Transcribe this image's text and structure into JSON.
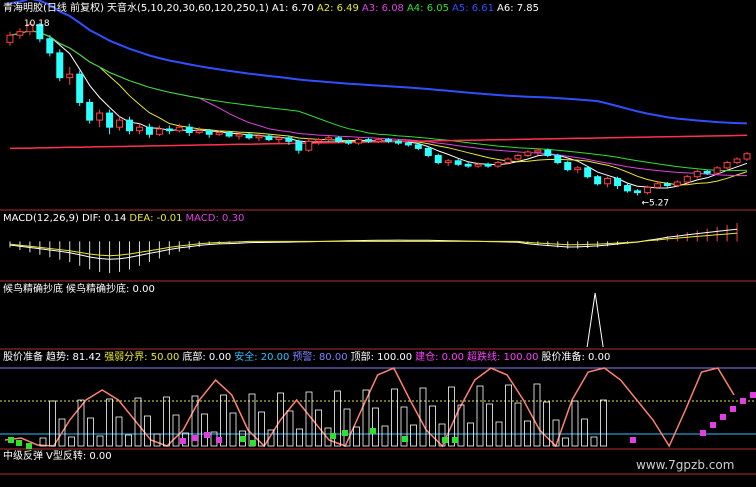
{
  "panel1": {
    "title": "青海明胶(日线 前复权)",
    "indicator": "天音水(5,10,20,30,60,120,250,1)",
    "readings": [
      {
        "label": "A1: 6.70",
        "color": "#ffffff"
      },
      {
        "label": "A2: 6.49",
        "color": "#e8e830"
      },
      {
        "label": "A3: 6.08",
        "color": "#e040e0"
      },
      {
        "label": "A4: 6.05",
        "color": "#30e030"
      },
      {
        "label": "A5: 6.61",
        "color": "#3050ff"
      },
      {
        "label": "A6: 7.85",
        "color": "#ffffff"
      }
    ],
    "high_label": "10.18",
    "low_label": "5.27"
  },
  "panel2": {
    "title": "MACD(12,26,9)",
    "readings": [
      {
        "label": "DIF: 0.14",
        "color": "#ffffff"
      },
      {
        "label": "DEA: -0.01",
        "color": "#e8e830"
      },
      {
        "label": "MACD: 0.30",
        "color": "#e040e0"
      }
    ]
  },
  "panel3": {
    "title": "候鸟精确抄底",
    "readings": [
      {
        "label": "候鸟精确抄底: 0.00",
        "color": "#ffffff"
      }
    ]
  },
  "panel4": {
    "title": "股价准备",
    "readings": [
      {
        "label": "趋势: 81.42",
        "color": "#ffffff"
      },
      {
        "label": "强弱分界: 50.00",
        "color": "#e8e830"
      },
      {
        "label": "底部: 0.00",
        "color": "#ffffff"
      },
      {
        "label": "安全: 20.00",
        "color": "#30c0ff"
      },
      {
        "label": "预警: 80.00",
        "color": "#8080ff"
      },
      {
        "label": "顶部: 100.00",
        "color": "#ffffff"
      },
      {
        "label": "建仓: 0.00",
        "color": "#ff40ff"
      },
      {
        "label": "超跌线: 100.00",
        "color": "#ff40ff"
      },
      {
        "label": "股价准备: 0.00",
        "color": "#ffffff"
      }
    ]
  },
  "panel5": {
    "title": "中级反弹",
    "readings": [
      {
        "label": "V型反转: 0.00",
        "color": "#ffffff"
      }
    ]
  },
  "watermark": "www.7gpzb.com",
  "colors": {
    "up": "#ff4040",
    "down": "#30ffff",
    "ma5": "#ffffff",
    "ma10": "#e8e830",
    "ma20": "#e040e0",
    "ma30": "#30e030",
    "ma60": "#3050ff",
    "ma250": "#ff3050",
    "divider": "#b03030"
  },
  "chart_data": [
    {
      "type": "candlestick",
      "title": "青海明胶(日线 前复权)",
      "candles": [
        [
          9.6,
          9.8,
          9.5,
          9.9
        ],
        [
          9.8,
          9.9,
          9.7,
          10.0
        ],
        [
          9.9,
          10.1,
          9.8,
          10.18
        ],
        [
          10.1,
          9.7,
          9.6,
          10.15
        ],
        [
          9.7,
          9.3,
          9.2,
          9.8
        ],
        [
          9.3,
          8.6,
          8.5,
          9.4
        ],
        [
          8.6,
          8.7,
          8.4,
          8.9
        ],
        [
          8.7,
          7.9,
          7.8,
          8.8
        ],
        [
          7.9,
          7.4,
          7.3,
          8.0
        ],
        [
          7.4,
          7.6,
          7.2,
          7.7
        ],
        [
          7.6,
          7.2,
          7.0,
          7.7
        ],
        [
          7.2,
          7.4,
          7.1,
          7.5
        ],
        [
          7.4,
          7.1,
          7.0,
          7.5
        ],
        [
          7.1,
          7.2,
          7.0,
          7.3
        ],
        [
          7.2,
          7.0,
          6.9,
          7.3
        ],
        [
          7.0,
          7.15,
          6.95,
          7.25
        ],
        [
          7.15,
          7.1,
          7.0,
          7.25
        ],
        [
          7.1,
          7.2,
          7.05,
          7.3
        ],
        [
          7.2,
          7.05,
          6.95,
          7.3
        ],
        [
          7.05,
          7.1,
          7.0,
          7.2
        ],
        [
          7.1,
          7.0,
          6.9,
          7.15
        ],
        [
          7.0,
          7.05,
          6.95,
          7.1
        ],
        [
          7.05,
          6.95,
          6.9,
          7.1
        ],
        [
          6.95,
          7.0,
          6.85,
          7.05
        ],
        [
          7.0,
          6.9,
          6.85,
          7.05
        ],
        [
          6.9,
          6.95,
          6.8,
          7.0
        ],
        [
          6.95,
          6.85,
          6.8,
          7.0
        ],
        [
          6.85,
          6.9,
          6.75,
          6.95
        ],
        [
          6.9,
          6.8,
          6.7,
          6.95
        ],
        [
          6.8,
          6.55,
          6.45,
          6.85
        ],
        [
          6.55,
          6.8,
          6.5,
          6.9
        ],
        [
          6.8,
          6.85,
          6.7,
          6.9
        ],
        [
          6.85,
          6.9,
          6.8,
          6.95
        ],
        [
          6.9,
          6.8,
          6.75,
          6.95
        ],
        [
          6.8,
          6.75,
          6.7,
          6.85
        ],
        [
          6.75,
          6.85,
          6.7,
          6.9
        ],
        [
          6.85,
          6.8,
          6.75,
          6.9
        ],
        [
          6.8,
          6.85,
          6.75,
          6.9
        ],
        [
          6.85,
          6.8,
          6.75,
          6.9
        ],
        [
          6.8,
          6.75,
          6.7,
          6.85
        ],
        [
          6.75,
          6.7,
          6.65,
          6.8
        ],
        [
          6.7,
          6.6,
          6.55,
          6.75
        ],
        [
          6.6,
          6.4,
          6.35,
          6.65
        ],
        [
          6.4,
          6.2,
          6.15,
          6.45
        ],
        [
          6.2,
          6.25,
          6.1,
          6.3
        ],
        [
          6.25,
          6.15,
          6.1,
          6.3
        ],
        [
          6.15,
          6.1,
          6.05,
          6.2
        ],
        [
          6.1,
          6.15,
          6.05,
          6.2
        ],
        [
          6.15,
          6.1,
          6.05,
          6.2
        ],
        [
          6.1,
          6.2,
          6.05,
          6.25
        ],
        [
          6.2,
          6.3,
          6.15,
          6.35
        ],
        [
          6.3,
          6.4,
          6.25,
          6.45
        ],
        [
          6.4,
          6.5,
          6.35,
          6.55
        ],
        [
          6.5,
          6.55,
          6.4,
          6.6
        ],
        [
          6.55,
          6.4,
          6.35,
          6.6
        ],
        [
          6.4,
          6.2,
          6.15,
          6.45
        ],
        [
          6.2,
          6.0,
          5.95,
          6.25
        ],
        [
          6.0,
          6.05,
          5.9,
          6.1
        ],
        [
          6.05,
          5.8,
          5.75,
          6.1
        ],
        [
          5.8,
          5.6,
          5.55,
          5.85
        ],
        [
          5.6,
          5.75,
          5.5,
          5.8
        ],
        [
          5.75,
          5.55,
          5.45,
          5.8
        ],
        [
          5.55,
          5.4,
          5.35,
          5.6
        ],
        [
          5.4,
          5.35,
          5.27,
          5.45
        ],
        [
          5.35,
          5.5,
          5.3,
          5.55
        ],
        [
          5.5,
          5.6,
          5.45,
          5.65
        ],
        [
          5.6,
          5.55,
          5.5,
          5.65
        ],
        [
          5.55,
          5.65,
          5.5,
          5.7
        ],
        [
          5.65,
          5.8,
          5.6,
          5.85
        ],
        [
          5.8,
          5.95,
          5.75,
          6.0
        ],
        [
          5.95,
          5.9,
          5.85,
          6.0
        ],
        [
          5.9,
          6.05,
          5.85,
          6.1
        ],
        [
          6.05,
          6.2,
          6.0,
          6.25
        ],
        [
          6.2,
          6.3,
          6.15,
          6.35
        ],
        [
          6.3,
          6.45,
          6.25,
          6.5
        ]
      ],
      "ylim": [
        5.0,
        10.4
      ]
    },
    {
      "type": "bar",
      "title": "MACD(12,26,9)",
      "macd": [
        -0.1,
        -0.14,
        -0.18,
        -0.22,
        -0.26,
        -0.3,
        -0.34,
        -0.4,
        -0.46,
        -0.5,
        -0.52,
        -0.5,
        -0.46,
        -0.4,
        -0.34,
        -0.28,
        -0.22,
        -0.17,
        -0.13,
        -0.09,
        -0.06,
        -0.04,
        -0.03,
        -0.02,
        0,
        0,
        0,
        0,
        0,
        0,
        0,
        0,
        0,
        0,
        0,
        0,
        0,
        0,
        0,
        0,
        0,
        0,
        0,
        0,
        0,
        0,
        0,
        0,
        0,
        0,
        0,
        0,
        -0.04,
        -0.06,
        -0.08,
        -0.1,
        -0.12,
        -0.12,
        -0.11,
        -0.1,
        -0.08,
        -0.06,
        -0.04,
        -0.02,
        0.02,
        0.05,
        0.09,
        0.12,
        0.15,
        0.18,
        0.21,
        0.24,
        0.27,
        0.3
      ],
      "ylim": [
        -0.6,
        0.35
      ]
    },
    {
      "type": "line",
      "title": "候鸟精确抄底",
      "spike_at": 0.79
    }
  ]
}
